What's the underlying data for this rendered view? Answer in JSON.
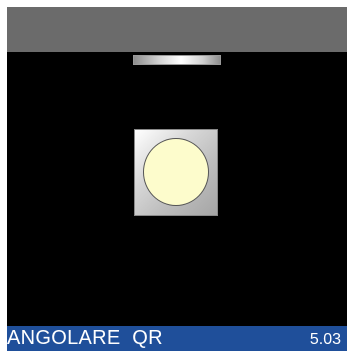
{
  "status_bar": {
    "title": "ANGOLARE  QR",
    "version": "5.03"
  },
  "colors": {
    "top_bar": "#6b6b6b",
    "viewport": "#000000",
    "status_bar": "#1f4f9a",
    "lamp": "#fdfccc"
  },
  "icons": {
    "top_fixture": "light-bar-icon",
    "lamp": "round-lamp-icon"
  }
}
